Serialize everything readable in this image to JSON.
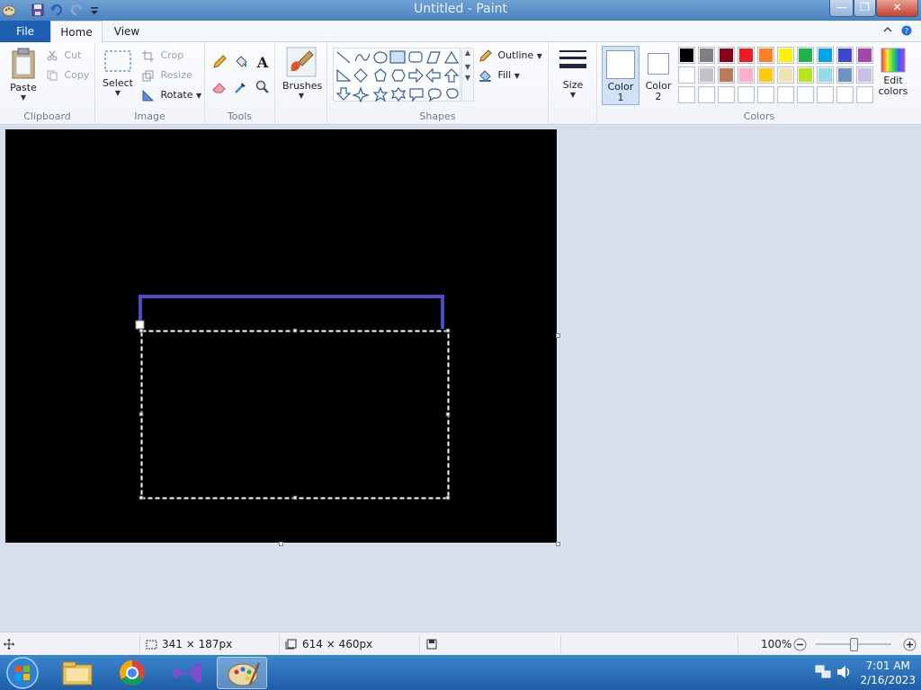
{
  "window": {
    "title": "Untitled - Paint",
    "minimize": "—",
    "maximize": "❐",
    "close": "✕"
  },
  "tabs": {
    "file": "File",
    "home": "Home",
    "view": "View"
  },
  "ribbon": {
    "clipboard": {
      "label": "Clipboard",
      "paste": "Paste",
      "cut": "Cut",
      "copy": "Copy"
    },
    "image": {
      "label": "Image",
      "select": "Select",
      "crop": "Crop",
      "resize": "Resize",
      "rotate": "Rotate"
    },
    "tools": {
      "label": "Tools"
    },
    "brushes": {
      "label": "Brushes"
    },
    "shapes": {
      "label": "Shapes",
      "outline": "Outline",
      "fill": "Fill"
    },
    "size": {
      "label": "Size"
    },
    "colors": {
      "label": "Colors",
      "color1_a": "Color",
      "color1_b": "1",
      "color2_a": "Color",
      "color2_b": "2",
      "edit_a": "Edit",
      "edit_b": "colors",
      "palette": [
        "#000000",
        "#7f7f7f",
        "#880015",
        "#ed1c24",
        "#ff7f27",
        "#fff200",
        "#22b14c",
        "#00a2e8",
        "#3f48cc",
        "#a349a4",
        "#ffffff",
        "#c3c3c3",
        "#b97a57",
        "#ffaec9",
        "#ffc90e",
        "#efe4b0",
        "#b5e61d",
        "#99d9ea",
        "#7092be",
        "#c8bfe7",
        "#ffffff",
        "#ffffff",
        "#ffffff",
        "#ffffff",
        "#ffffff",
        "#ffffff",
        "#ffffff",
        "#ffffff",
        "#ffffff",
        "#ffffff"
      ]
    }
  },
  "status": {
    "selection_size": "341 × 187px",
    "image_size": "614 × 460px",
    "zoom": "100%"
  },
  "taskbar": {
    "time": "7:01 AM",
    "date": "2/16/2023"
  }
}
